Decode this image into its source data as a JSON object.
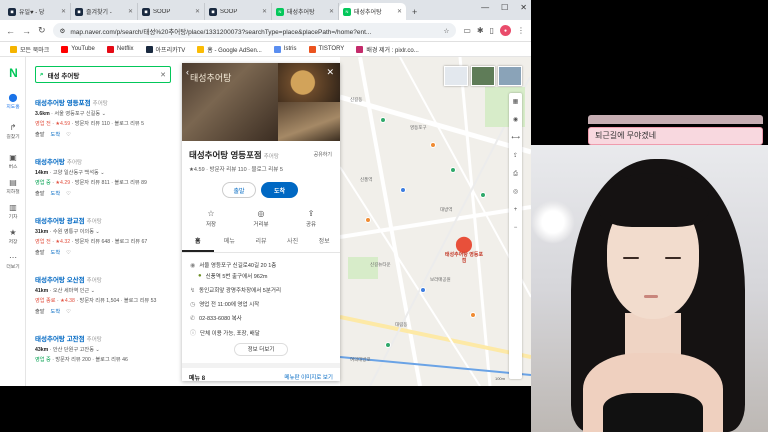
{
  "browser": {
    "tabs": [
      {
        "label": "유일♥ - 당"
      },
      {
        "label": "즐겨찾기 -"
      },
      {
        "label": "SOOP"
      },
      {
        "label": "SOOP"
      },
      {
        "label": "태성추어탕"
      },
      {
        "label": "태성추어탕"
      }
    ],
    "url": "map.naver.com/p/search/태성%20추어탕/place/1331200073?searchType=place&placePath=/home?ent..."
  },
  "bookmarks": [
    {
      "label": "모든 북마크",
      "color": "#f5b400"
    },
    {
      "label": "YouTube",
      "color": "#ff0000"
    },
    {
      "label": "Netflix",
      "color": "#e50914"
    },
    {
      "label": "아프리카TV",
      "color": "#1a2a40"
    },
    {
      "label": "홈 - Google AdSen...",
      "color": "#fbbc04"
    },
    {
      "label": "Istris",
      "color": "#5a8ef0"
    },
    {
      "label": "TISTORY",
      "color": "#eb531f"
    },
    {
      "label": "배경 제거 : pixlr.co...",
      "color": "#c42b6b"
    }
  ],
  "leftnav": [
    {
      "label": "지도홈"
    },
    {
      "label": "길찾기"
    },
    {
      "label": "버스"
    },
    {
      "label": "지하철"
    },
    {
      "label": "기차"
    },
    {
      "label": "저장"
    },
    {
      "label": "더보기"
    }
  ],
  "search": {
    "query": "태성 추어탕"
  },
  "results": [
    {
      "name": "태성추어탕 영등포점",
      "cat": "추어탕",
      "dist": "3.6km",
      "addr": "서울 영등포구 신길동",
      "status": "영업 전",
      "rating": "★4.59",
      "reviews": "방문자 리뷰 110 · 블로그 리뷰 5",
      "a1": "출발",
      "a2": "도착"
    },
    {
      "name": "태성추어탕",
      "cat": "추어탕",
      "dist": "14km",
      "addr": "고양 일산동구 백석동",
      "status": "영업 중",
      "rating": "★4.29",
      "reviews": "방문자 리뷰 811 · 블로그 리뷰 89",
      "a1": "출발",
      "a2": "도착"
    },
    {
      "name": "태성추어탕 광교점",
      "cat": "추어탕",
      "dist": "31km",
      "addr": "수원 영통구 이의동",
      "status": "영업 전",
      "rating": "★4.32",
      "reviews": "방문자 리뷰 648 · 블로그 리뷰 67",
      "a1": "출발",
      "a2": "도착"
    },
    {
      "name": "태성추어탕 오산점",
      "cat": "추어탕",
      "dist": "41km",
      "addr": "오산 세마역 인근",
      "status": "영업 종료",
      "rating": "★4.38",
      "reviews": "방문자 리뷰 1,504 · 블로그 리뷰 53",
      "a1": "출발",
      "a2": "도착"
    },
    {
      "name": "태성추어탕 고잔점",
      "cat": "추어탕",
      "dist": "43km",
      "addr": "안산 단원구 고잔동",
      "status": "영업 중",
      "rating": "",
      "reviews": "방문자 리뷰 200 · 블로그 리뷰 46",
      "a1": "",
      "a2": ""
    }
  ],
  "place": {
    "sign": "태성추어탕",
    "name": "태성추어탕 영등포점",
    "cat": "추어탕",
    "save": "공유하기",
    "rating": "★4.59 · 방문자 리뷰 110 · 블로그 리뷰 5",
    "depart": "출발",
    "arrive": "도착",
    "actions": [
      {
        "label": "저장",
        "icon": "☆"
      },
      {
        "label": "거리뷰",
        "icon": "◎"
      },
      {
        "label": "공유",
        "icon": "⇪"
      }
    ],
    "tabs": [
      "홈",
      "메뉴",
      "리뷰",
      "사진",
      "정보"
    ],
    "address": "서울 영등포구 신길로40길 20 1층",
    "subway": "신풍역 5번 출구에서 962m",
    "note": "동인교회앞 광명주차장에서 5분거리",
    "hours": "영업 전  11:00에 영업 시작",
    "phone": "02-833-6080 복사",
    "service": "단체 이용 가능, 포장, 배달",
    "more": "정보 더보기",
    "menu_label": "메뉴 8",
    "menu_link": "메뉴판 이미지로 보기"
  },
  "map": {
    "pin_label": "태성추어탕 영등포점",
    "labels": [
      "신길동",
      "영등포구",
      "대방역",
      "신풍역",
      "보라매공원",
      "신길뉴타운",
      "대림동",
      "여의대방로"
    ],
    "scale": "100m"
  },
  "stream": {
    "chat": "퇴근길에 무야겠네"
  }
}
